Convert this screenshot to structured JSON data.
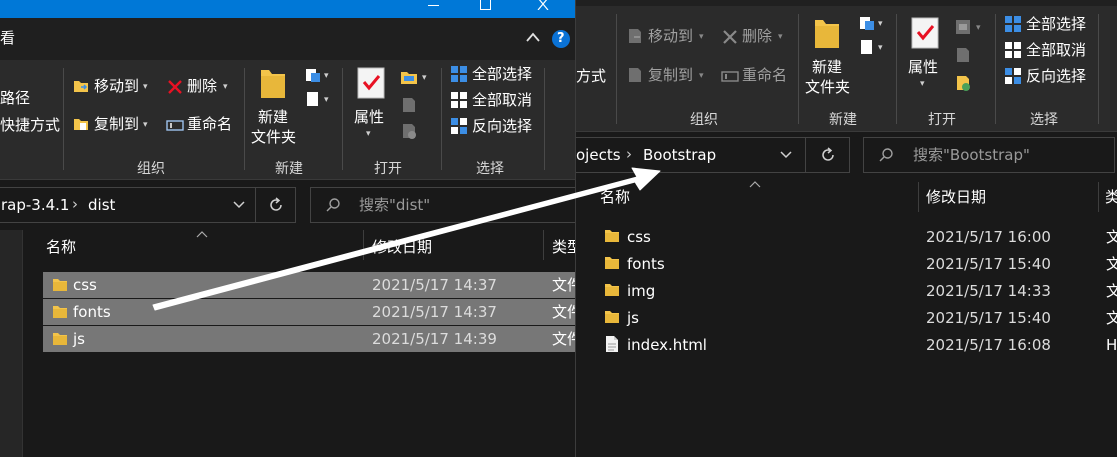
{
  "left_window": {
    "view_tab": "看",
    "ribbon": {
      "partial_items": [
        "路径",
        "快捷方式"
      ],
      "organize": {
        "move_to": "移动到",
        "copy_to": "复制到",
        "delete": "删除",
        "rename": "重命名",
        "label": "组织"
      },
      "new": {
        "new_folder": "新建\n文件夹",
        "new_folder_line1": "新建",
        "new_folder_line2": "文件夹",
        "label": "新建"
      },
      "open": {
        "properties": "属性",
        "label": "打开"
      },
      "select": {
        "select_all": "全部选择",
        "select_none": "全部取消",
        "invert": "反向选择",
        "label": "选择"
      }
    },
    "address": {
      "path_partial": "rap-3.4.1",
      "current": "dist"
    },
    "search": {
      "placeholder": "搜索\"dist\""
    },
    "columns": {
      "name": "名称",
      "date": "修改日期",
      "type": "类型"
    },
    "files": [
      {
        "name": "css",
        "date": "2021/5/17 14:37",
        "type": "文件"
      },
      {
        "name": "fonts",
        "date": "2021/5/17 14:37",
        "type": "文件"
      },
      {
        "name": "js",
        "date": "2021/5/17 14:39",
        "type": "文件"
      }
    ]
  },
  "right_window": {
    "ribbon": {
      "partial_item": "方式",
      "organize": {
        "move_to": "移动到",
        "copy_to": "复制到",
        "delete": "删除",
        "rename": "重命名",
        "label": "组织"
      },
      "new": {
        "new_folder_line1": "新建",
        "new_folder_line2": "文件夹",
        "label": "新建"
      },
      "open": {
        "properties": "属性",
        "label": "打开"
      },
      "select": {
        "select_all": "全部选择",
        "select_none": "全部取消",
        "invert": "反向选择",
        "label": "选择"
      }
    },
    "address": {
      "path_partial": "ojects",
      "current": "Bootstrap"
    },
    "search": {
      "placeholder": "搜索\"Bootstrap\""
    },
    "columns": {
      "name": "名称",
      "date": "修改日期",
      "type": "类"
    },
    "files": [
      {
        "name": "css",
        "date": "2021/5/17 16:00",
        "type": "文",
        "kind": "folder"
      },
      {
        "name": "fonts",
        "date": "2021/5/17 15:40",
        "type": "文",
        "kind": "folder"
      },
      {
        "name": "img",
        "date": "2021/5/17 14:33",
        "type": "文",
        "kind": "folder"
      },
      {
        "name": "js",
        "date": "2021/5/17 15:40",
        "type": "文",
        "kind": "folder"
      },
      {
        "name": "index.html",
        "date": "2021/5/17 16:08",
        "type": "H",
        "kind": "file"
      }
    ]
  },
  "colors": {
    "titlebar_blue": "#0078d7",
    "ribbon_bg": "#2b2b2b",
    "content_bg": "#191919",
    "selection": "#777777",
    "folder_yellow": "#f3c44a",
    "delete_red": "#e81123",
    "select_icon_blue": "#3c8ee5",
    "arrow": "#ffffff"
  }
}
